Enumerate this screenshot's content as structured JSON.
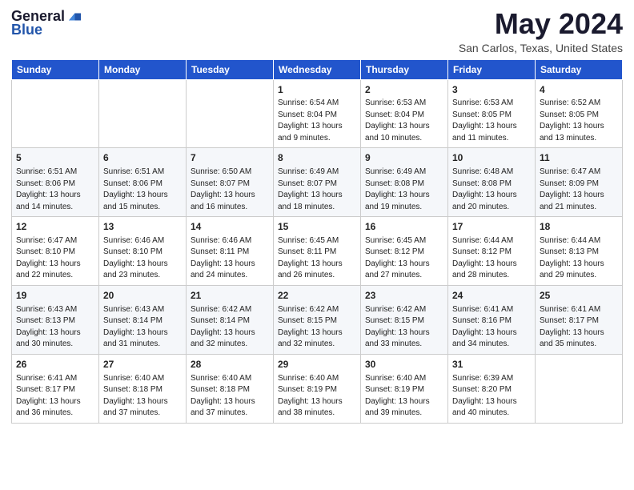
{
  "logo": {
    "general": "General",
    "blue": "Blue"
  },
  "title": "May 2024",
  "subtitle": "San Carlos, Texas, United States",
  "days_of_week": [
    "Sunday",
    "Monday",
    "Tuesday",
    "Wednesday",
    "Thursday",
    "Friday",
    "Saturday"
  ],
  "weeks": [
    [
      {
        "day": "",
        "sunrise": "",
        "sunset": "",
        "daylight": ""
      },
      {
        "day": "",
        "sunrise": "",
        "sunset": "",
        "daylight": ""
      },
      {
        "day": "",
        "sunrise": "",
        "sunset": "",
        "daylight": ""
      },
      {
        "day": "1",
        "sunrise": "Sunrise: 6:54 AM",
        "sunset": "Sunset: 8:04 PM",
        "daylight": "Daylight: 13 hours and 9 minutes."
      },
      {
        "day": "2",
        "sunrise": "Sunrise: 6:53 AM",
        "sunset": "Sunset: 8:04 PM",
        "daylight": "Daylight: 13 hours and 10 minutes."
      },
      {
        "day": "3",
        "sunrise": "Sunrise: 6:53 AM",
        "sunset": "Sunset: 8:05 PM",
        "daylight": "Daylight: 13 hours and 11 minutes."
      },
      {
        "day": "4",
        "sunrise": "Sunrise: 6:52 AM",
        "sunset": "Sunset: 8:05 PM",
        "daylight": "Daylight: 13 hours and 13 minutes."
      }
    ],
    [
      {
        "day": "5",
        "sunrise": "Sunrise: 6:51 AM",
        "sunset": "Sunset: 8:06 PM",
        "daylight": "Daylight: 13 hours and 14 minutes."
      },
      {
        "day": "6",
        "sunrise": "Sunrise: 6:51 AM",
        "sunset": "Sunset: 8:06 PM",
        "daylight": "Daylight: 13 hours and 15 minutes."
      },
      {
        "day": "7",
        "sunrise": "Sunrise: 6:50 AM",
        "sunset": "Sunset: 8:07 PM",
        "daylight": "Daylight: 13 hours and 16 minutes."
      },
      {
        "day": "8",
        "sunrise": "Sunrise: 6:49 AM",
        "sunset": "Sunset: 8:07 PM",
        "daylight": "Daylight: 13 hours and 18 minutes."
      },
      {
        "day": "9",
        "sunrise": "Sunrise: 6:49 AM",
        "sunset": "Sunset: 8:08 PM",
        "daylight": "Daylight: 13 hours and 19 minutes."
      },
      {
        "day": "10",
        "sunrise": "Sunrise: 6:48 AM",
        "sunset": "Sunset: 8:08 PM",
        "daylight": "Daylight: 13 hours and 20 minutes."
      },
      {
        "day": "11",
        "sunrise": "Sunrise: 6:47 AM",
        "sunset": "Sunset: 8:09 PM",
        "daylight": "Daylight: 13 hours and 21 minutes."
      }
    ],
    [
      {
        "day": "12",
        "sunrise": "Sunrise: 6:47 AM",
        "sunset": "Sunset: 8:10 PM",
        "daylight": "Daylight: 13 hours and 22 minutes."
      },
      {
        "day": "13",
        "sunrise": "Sunrise: 6:46 AM",
        "sunset": "Sunset: 8:10 PM",
        "daylight": "Daylight: 13 hours and 23 minutes."
      },
      {
        "day": "14",
        "sunrise": "Sunrise: 6:46 AM",
        "sunset": "Sunset: 8:11 PM",
        "daylight": "Daylight: 13 hours and 24 minutes."
      },
      {
        "day": "15",
        "sunrise": "Sunrise: 6:45 AM",
        "sunset": "Sunset: 8:11 PM",
        "daylight": "Daylight: 13 hours and 26 minutes."
      },
      {
        "day": "16",
        "sunrise": "Sunrise: 6:45 AM",
        "sunset": "Sunset: 8:12 PM",
        "daylight": "Daylight: 13 hours and 27 minutes."
      },
      {
        "day": "17",
        "sunrise": "Sunrise: 6:44 AM",
        "sunset": "Sunset: 8:12 PM",
        "daylight": "Daylight: 13 hours and 28 minutes."
      },
      {
        "day": "18",
        "sunrise": "Sunrise: 6:44 AM",
        "sunset": "Sunset: 8:13 PM",
        "daylight": "Daylight: 13 hours and 29 minutes."
      }
    ],
    [
      {
        "day": "19",
        "sunrise": "Sunrise: 6:43 AM",
        "sunset": "Sunset: 8:13 PM",
        "daylight": "Daylight: 13 hours and 30 minutes."
      },
      {
        "day": "20",
        "sunrise": "Sunrise: 6:43 AM",
        "sunset": "Sunset: 8:14 PM",
        "daylight": "Daylight: 13 hours and 31 minutes."
      },
      {
        "day": "21",
        "sunrise": "Sunrise: 6:42 AM",
        "sunset": "Sunset: 8:14 PM",
        "daylight": "Daylight: 13 hours and 32 minutes."
      },
      {
        "day": "22",
        "sunrise": "Sunrise: 6:42 AM",
        "sunset": "Sunset: 8:15 PM",
        "daylight": "Daylight: 13 hours and 32 minutes."
      },
      {
        "day": "23",
        "sunrise": "Sunrise: 6:42 AM",
        "sunset": "Sunset: 8:15 PM",
        "daylight": "Daylight: 13 hours and 33 minutes."
      },
      {
        "day": "24",
        "sunrise": "Sunrise: 6:41 AM",
        "sunset": "Sunset: 8:16 PM",
        "daylight": "Daylight: 13 hours and 34 minutes."
      },
      {
        "day": "25",
        "sunrise": "Sunrise: 6:41 AM",
        "sunset": "Sunset: 8:17 PM",
        "daylight": "Daylight: 13 hours and 35 minutes."
      }
    ],
    [
      {
        "day": "26",
        "sunrise": "Sunrise: 6:41 AM",
        "sunset": "Sunset: 8:17 PM",
        "daylight": "Daylight: 13 hours and 36 minutes."
      },
      {
        "day": "27",
        "sunrise": "Sunrise: 6:40 AM",
        "sunset": "Sunset: 8:18 PM",
        "daylight": "Daylight: 13 hours and 37 minutes."
      },
      {
        "day": "28",
        "sunrise": "Sunrise: 6:40 AM",
        "sunset": "Sunset: 8:18 PM",
        "daylight": "Daylight: 13 hours and 37 minutes."
      },
      {
        "day": "29",
        "sunrise": "Sunrise: 6:40 AM",
        "sunset": "Sunset: 8:19 PM",
        "daylight": "Daylight: 13 hours and 38 minutes."
      },
      {
        "day": "30",
        "sunrise": "Sunrise: 6:40 AM",
        "sunset": "Sunset: 8:19 PM",
        "daylight": "Daylight: 13 hours and 39 minutes."
      },
      {
        "day": "31",
        "sunrise": "Sunrise: 6:39 AM",
        "sunset": "Sunset: 8:20 PM",
        "daylight": "Daylight: 13 hours and 40 minutes."
      },
      {
        "day": "",
        "sunrise": "",
        "sunset": "",
        "daylight": ""
      }
    ]
  ]
}
